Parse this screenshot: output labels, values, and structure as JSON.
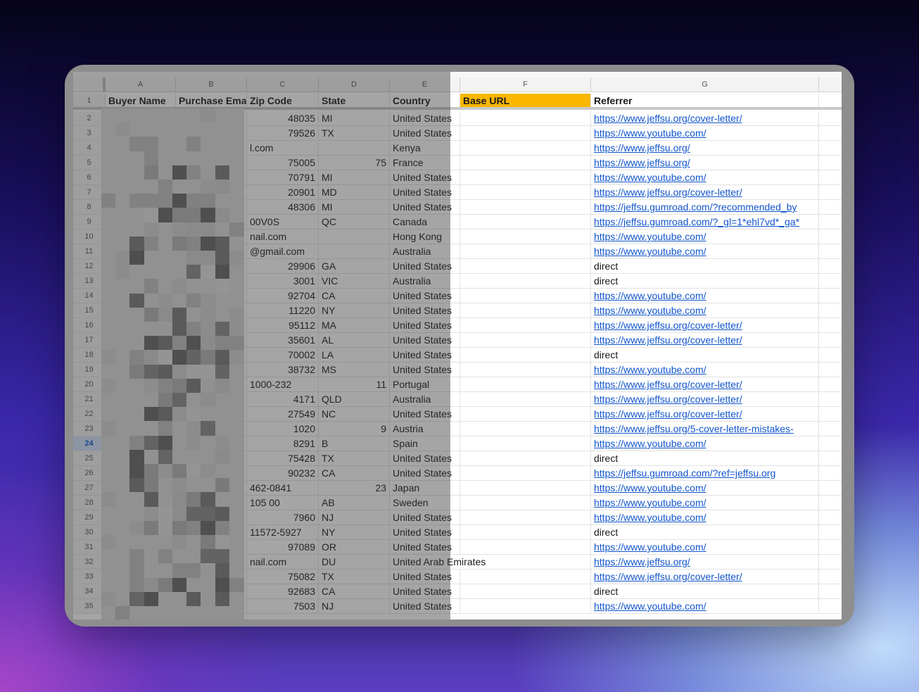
{
  "columns": [
    "A",
    "B",
    "C",
    "D",
    "E",
    "F",
    "G"
  ],
  "header_row": {
    "num": "1",
    "buyer_name": "Buyer Name",
    "purchase_email": "Purchase Ema",
    "zip_code": "Zip Code",
    "state": "State",
    "country": "Country",
    "base_url": "Base URL",
    "referrer": "Referrer"
  },
  "rows": [
    {
      "num": "2",
      "zip": "48035",
      "zip_num": true,
      "state": "MI",
      "state_num": false,
      "country": "United States",
      "referrer": "https://www.jeffsu.org/cover-letter/",
      "link": true
    },
    {
      "num": "3",
      "zip": "79526",
      "zip_num": true,
      "state": "TX",
      "state_num": false,
      "country": "United States",
      "referrer": "https://www.youtube.com/",
      "link": true
    },
    {
      "num": "4",
      "zip": "l.com",
      "zip_num": false,
      "state": "",
      "state_num": false,
      "country": "Kenya",
      "referrer": "https://www.jeffsu.org/",
      "link": true
    },
    {
      "num": "5",
      "zip": "75005",
      "zip_num": true,
      "state": "75",
      "state_num": true,
      "country": "France",
      "referrer": "https://www.jeffsu.org/",
      "link": true
    },
    {
      "num": "6",
      "zip": "70791",
      "zip_num": true,
      "state": "MI",
      "state_num": false,
      "country": "United States",
      "referrer": "https://www.youtube.com/",
      "link": true
    },
    {
      "num": "7",
      "zip": "20901",
      "zip_num": true,
      "state": "MD",
      "state_num": false,
      "country": "United States",
      "referrer": "https://www.jeffsu.org/cover-letter/",
      "link": true
    },
    {
      "num": "8",
      "zip": "48306",
      "zip_num": true,
      "state": "MI",
      "state_num": false,
      "country": "United States",
      "referrer": "https://jeffsu.gumroad.com/?recommended_by",
      "link": true
    },
    {
      "num": "9",
      "zip": "00V0S",
      "zip_num": false,
      "state": "QC",
      "state_num": false,
      "country": "Canada",
      "referrer": "https://jeffsu.gumroad.com/?_gl=1*ehl7vd*_ga*",
      "link": true
    },
    {
      "num": "10",
      "zip": "nail.com",
      "zip_num": false,
      "state": "",
      "state_num": false,
      "country": "Hong Kong",
      "referrer": "https://www.youtube.com/",
      "link": true
    },
    {
      "num": "11",
      "zip": "@gmail.com",
      "zip_num": false,
      "state": "",
      "state_num": false,
      "country": "Australia",
      "referrer": "https://www.youtube.com/",
      "link": true
    },
    {
      "num": "12",
      "zip": "29906",
      "zip_num": true,
      "state": "GA",
      "state_num": false,
      "country": "United States",
      "referrer": "direct",
      "link": false
    },
    {
      "num": "13",
      "zip": "3001",
      "zip_num": true,
      "state": "VIC",
      "state_num": false,
      "country": "Australia",
      "referrer": "direct",
      "link": false
    },
    {
      "num": "14",
      "zip": "92704",
      "zip_num": true,
      "state": "CA",
      "state_num": false,
      "country": "United States",
      "referrer": "https://www.youtube.com/",
      "link": true
    },
    {
      "num": "15",
      "zip": "11220",
      "zip_num": true,
      "state": "NY",
      "state_num": false,
      "country": "United States",
      "referrer": "https://www.youtube.com/",
      "link": true
    },
    {
      "num": "16",
      "zip": "95112",
      "zip_num": true,
      "state": "MA",
      "state_num": false,
      "country": "United States",
      "referrer": "https://www.jeffsu.org/cover-letter/",
      "link": true
    },
    {
      "num": "17",
      "zip": "35601",
      "zip_num": true,
      "state": "AL",
      "state_num": false,
      "country": "United States",
      "referrer": "https://www.jeffsu.org/cover-letter/",
      "link": true
    },
    {
      "num": "18",
      "zip": "70002",
      "zip_num": true,
      "state": "LA",
      "state_num": false,
      "country": "United States",
      "referrer": "direct",
      "link": false
    },
    {
      "num": "19",
      "zip": "38732",
      "zip_num": true,
      "state": "MS",
      "state_num": false,
      "country": "United States",
      "referrer": "https://www.youtube.com/",
      "link": true
    },
    {
      "num": "20",
      "zip": "1000-232",
      "zip_num": false,
      "state": "11",
      "state_num": true,
      "country": "Portugal",
      "referrer": "https://www.jeffsu.org/cover-letter/",
      "link": true
    },
    {
      "num": "21",
      "zip": "4171",
      "zip_num": true,
      "state": "QLD",
      "state_num": false,
      "country": "Australia",
      "referrer": "https://www.jeffsu.org/cover-letter/",
      "link": true
    },
    {
      "num": "22",
      "zip": "27549",
      "zip_num": true,
      "state": "NC",
      "state_num": false,
      "country": "United States",
      "referrer": "https://www.jeffsu.org/cover-letter/",
      "link": true
    },
    {
      "num": "23",
      "zip": "1020",
      "zip_num": true,
      "state": "9",
      "state_num": true,
      "country": "Austria",
      "referrer": "https://www.jeffsu.org/5-cover-letter-mistakes-",
      "link": true
    },
    {
      "num": "24",
      "zip": "8291",
      "zip_num": true,
      "state": "B",
      "state_num": false,
      "country": "Spain",
      "referrer": "https://www.youtube.com/",
      "link": true,
      "selected": true
    },
    {
      "num": "25",
      "zip": "75428",
      "zip_num": true,
      "state": "TX",
      "state_num": false,
      "country": "United States",
      "referrer": "direct",
      "link": false
    },
    {
      "num": "26",
      "zip": "90232",
      "zip_num": true,
      "state": "CA",
      "state_num": false,
      "country": "United States",
      "referrer": "https://jeffsu.gumroad.com/?ref=jeffsu.org",
      "link": true
    },
    {
      "num": "27",
      "zip": "462-0841",
      "zip_num": false,
      "state": "23",
      "state_num": true,
      "country": "Japan",
      "referrer": "https://www.youtube.com/",
      "link": true
    },
    {
      "num": "28",
      "zip": "105 00",
      "zip_num": false,
      "state": "AB",
      "state_num": false,
      "country": "Sweden",
      "referrer": "https://www.youtube.com/",
      "link": true
    },
    {
      "num": "29",
      "zip": "7960",
      "zip_num": true,
      "state": "NJ",
      "state_num": false,
      "country": "United States",
      "referrer": "https://www.youtube.com/",
      "link": true
    },
    {
      "num": "30",
      "zip": "11572-5927",
      "zip_num": false,
      "state": "NY",
      "state_num": false,
      "country": "United States",
      "referrer": "direct",
      "link": false
    },
    {
      "num": "31",
      "zip": "97089",
      "zip_num": true,
      "state": "OR",
      "state_num": false,
      "country": "United States",
      "referrer": "https://www.youtube.com/",
      "link": true
    },
    {
      "num": "32",
      "zip": "nail.com",
      "zip_num": false,
      "state": "DU",
      "state_num": false,
      "country": "United Arab Emirates",
      "referrer": "https://www.jeffsu.org/",
      "link": true
    },
    {
      "num": "33",
      "zip": "75082",
      "zip_num": true,
      "state": "TX",
      "state_num": false,
      "country": "United States",
      "referrer": "https://www.jeffsu.org/cover-letter/",
      "link": true
    },
    {
      "num": "34",
      "zip": "92683",
      "zip_num": true,
      "state": "CA",
      "state_num": false,
      "country": "United States",
      "referrer": "direct",
      "link": false
    },
    {
      "num": "35",
      "zip": "7503",
      "zip_num": true,
      "state": "NJ",
      "state_num": false,
      "country": "United States",
      "referrer": "https://www.youtube.com/",
      "link": true
    }
  ],
  "colors": {
    "highlight": "#f9b700",
    "link": "#1155cc",
    "selected_row": "#d3e2fd"
  }
}
